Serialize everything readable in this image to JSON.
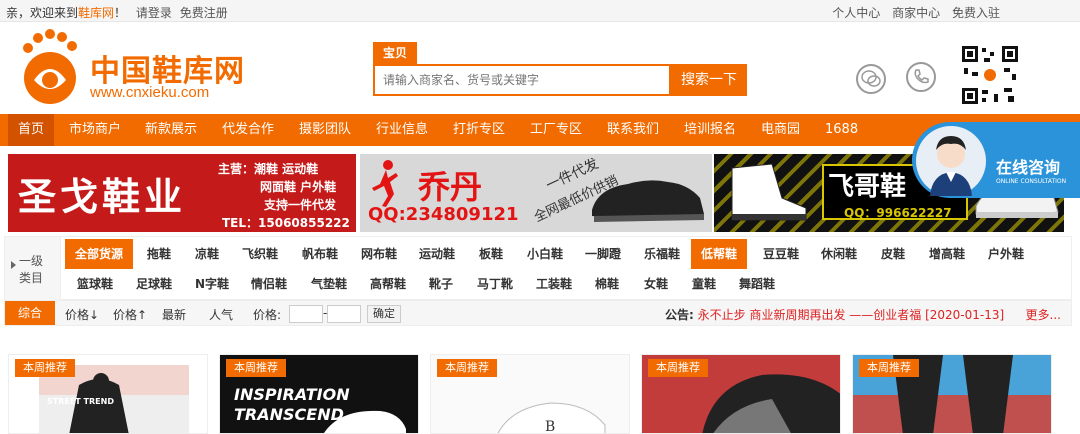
{
  "topbar": {
    "welcome_prefix": "亲，欢迎来到",
    "site_name": "鞋库网",
    "welcome_suffix": "！",
    "login": "请登录",
    "register": "免费注册",
    "personal_center": "个人中心",
    "merchant_center": "商家中心",
    "free_join": "免费入驻"
  },
  "logo": {
    "cn": "中国鞋库网",
    "en": "www.cnxieku.com"
  },
  "search": {
    "tab": "宝贝",
    "placeholder": "请输入商家名、货号或关键字",
    "button": "搜索一下"
  },
  "nav": {
    "items": [
      "首页",
      "市场商户",
      "新款展示",
      "代发合作",
      "摄影团队",
      "行业信息",
      "打折专区",
      "工厂专区",
      "联系我们",
      "培训报名",
      "电商园",
      "1688"
    ]
  },
  "banners": {
    "b1": {
      "name": "圣戈鞋业",
      "line1": "主营：潮鞋  运动鞋",
      "line2": "网面鞋 户外鞋",
      "line3": "支持一件代发",
      "tel": "TEL：15060855222"
    },
    "b2": {
      "brand": "乔丹",
      "qq": "QQ:234809121",
      "slogan1": "一件代发",
      "slogan2": "全网最低价供销"
    },
    "b3": {
      "brand": "飞哥鞋",
      "qq": "QQ：996622227"
    }
  },
  "consult": {
    "title": "在线咨询",
    "subtitle": "ONLINE CONSULTATION"
  },
  "category": {
    "label_line1": "一级",
    "label_line2": "类目",
    "row1": [
      "全部货源",
      "拖鞋",
      "凉鞋",
      "飞织鞋",
      "帆布鞋",
      "网布鞋",
      "运动鞋",
      "板鞋",
      "小白鞋",
      "一脚蹬",
      "乐福鞋",
      "低帮鞋",
      "豆豆鞋",
      "休闲鞋",
      "皮鞋",
      "增高鞋",
      "户外鞋"
    ],
    "row2": [
      "篮球鞋",
      "足球鞋",
      "N字鞋",
      "情侣鞋",
      "气垫鞋",
      "高帮鞋",
      "靴子",
      "马丁靴",
      "工装鞋",
      "棉鞋",
      "女鞋",
      "童鞋",
      "舞蹈鞋"
    ]
  },
  "filter": {
    "comprehensive": "综合",
    "price_down": "价格↓",
    "price_up": "价格↑",
    "newest": "最新",
    "popular": "人气",
    "price_label": "价格:",
    "dash": "-",
    "confirm": "确定",
    "notice_label": "公告:",
    "notice_text": "永不止步 商业新周期再出发 ——创业者福 [2020-01-13]",
    "more": "更多..."
  },
  "products": {
    "tag": "本周推荐",
    "card2_text1": "INSPIRATION",
    "card2_text2": "TRANSCEND",
    "card1_text": "STREET TREND"
  },
  "colors": {
    "accent": "#f26b00",
    "nav_active": "#d35200",
    "consult": "#2b93d9"
  }
}
